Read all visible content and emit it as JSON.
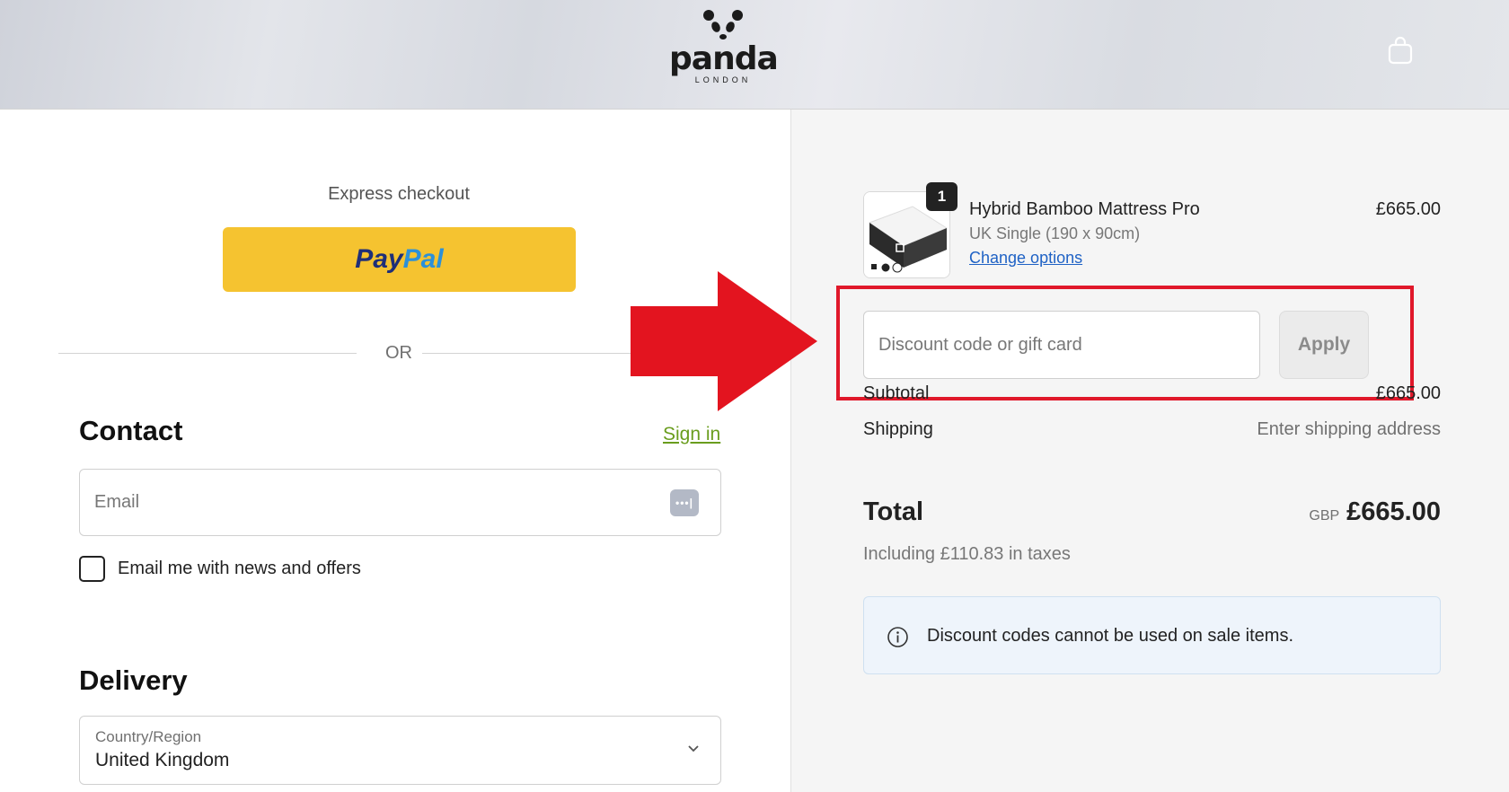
{
  "header": {
    "logo_word": "panda",
    "logo_sub": "LONDON",
    "cart_icon": "shopping-bag-icon"
  },
  "express": {
    "label": "Express checkout",
    "paypal_part1": "Pay",
    "paypal_part2": "Pal",
    "or_text": "OR"
  },
  "contact": {
    "title": "Contact",
    "sign_in": "Sign in",
    "email_placeholder": "Email",
    "newsletter_label": "Email me with news and offers"
  },
  "delivery": {
    "title": "Delivery",
    "country_label": "Country/Region",
    "country_value": "United Kingdom"
  },
  "order": {
    "item": {
      "quantity": "1",
      "title": "Hybrid Bamboo Mattress Pro",
      "variant": "UK Single (190 x 90cm)",
      "change_options": "Change options",
      "price": "£665.00"
    },
    "discount": {
      "placeholder": "Discount code or gift card",
      "apply_label": "Apply"
    },
    "summary": {
      "subtotal_label": "Subtotal",
      "subtotal_value": "£665.00",
      "shipping_label": "Shipping",
      "shipping_value": "Enter shipping address",
      "total_label": "Total",
      "total_currency": "GBP",
      "total_value": "£665.00",
      "taxes_text": "Including £110.83 in taxes"
    },
    "notice": "Discount codes cannot be used on sale items."
  },
  "colors": {
    "paypal_yellow": "#f5c330",
    "sign_in_green": "#6a9d1e",
    "link_blue": "#1f62c5",
    "highlight_red": "#e0182a"
  }
}
